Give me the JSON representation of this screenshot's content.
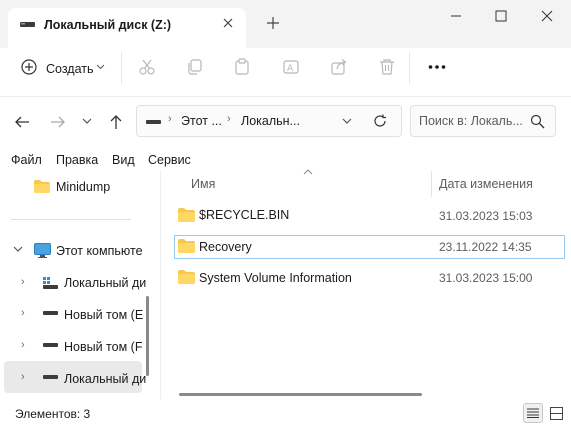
{
  "window": {
    "tab_title": "Локальный диск (Z:)"
  },
  "toolbar": {
    "create_label": "Создать"
  },
  "address": {
    "crumb_1": "Этот ...",
    "crumb_2": "Локальн..."
  },
  "search": {
    "placeholder": "Поиск в: Локаль..."
  },
  "menu": {
    "items": [
      "Файл",
      "Правка",
      "Вид",
      "Сервис"
    ]
  },
  "nav": {
    "items": [
      {
        "label": "Minidump"
      },
      {
        "label": "Этот компьюте"
      },
      {
        "label": "Локальный ди"
      },
      {
        "label": "Новый том (E"
      },
      {
        "label": "Новый том (F"
      },
      {
        "label": "Локальный ди"
      }
    ]
  },
  "list": {
    "col_name": "Имя",
    "col_date": "Дата изменения",
    "rows": [
      {
        "name": "$RECYCLE.BIN",
        "date": "31.03.2023 15:03"
      },
      {
        "name": "Recovery",
        "date": "23.11.2022 14:35"
      },
      {
        "name": "System Volume Information",
        "date": "31.03.2023 15:00"
      }
    ]
  },
  "status": {
    "items_count": "Элементов: 3"
  },
  "colors": {
    "folder": "#f6c84c",
    "accent": "#0067c0",
    "selected_row_border": "#99c9ef"
  }
}
